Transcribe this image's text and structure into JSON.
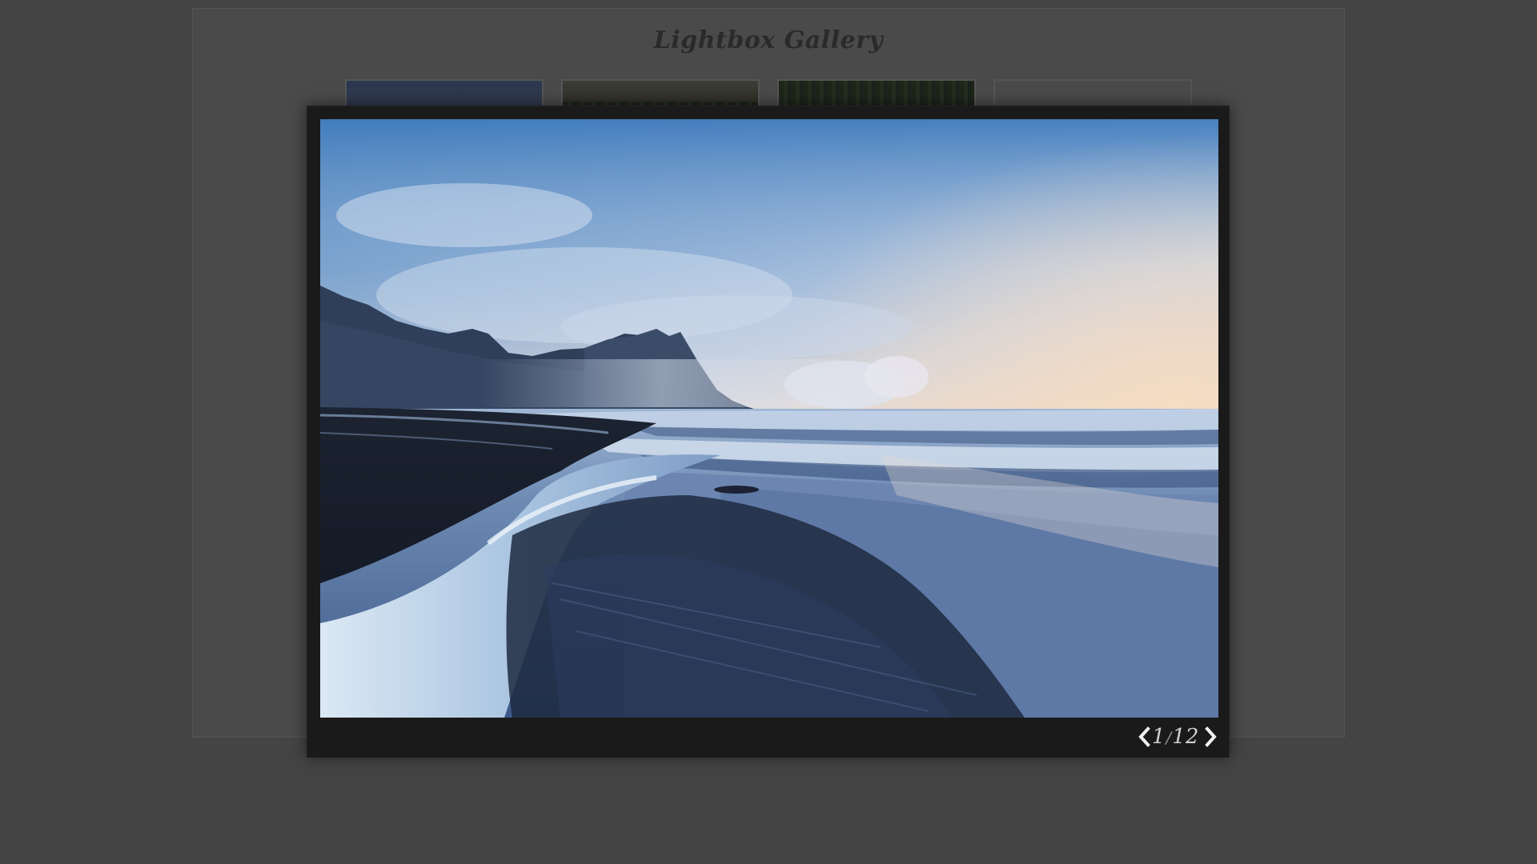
{
  "gallery": {
    "title": "Lightbox Gallery"
  },
  "lightbox": {
    "counter": {
      "current": "1",
      "separator": "/",
      "total": "12"
    },
    "prev_icon": "chevron-left-icon",
    "next_icon": "chevron-right-icon"
  },
  "colors": {
    "overlay_background": "#444444",
    "lightbox_frame": "#1a1a1a",
    "counter_text": "#cfcfcf"
  }
}
